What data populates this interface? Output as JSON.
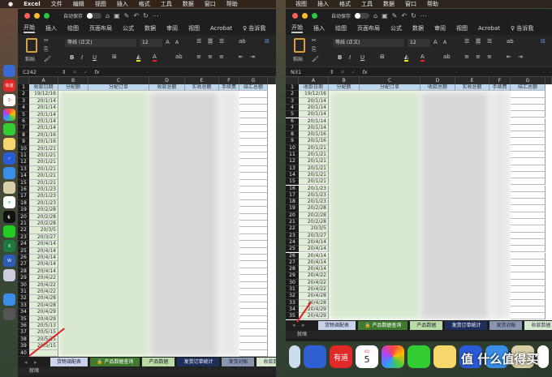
{
  "menubar": {
    "app": "Excel",
    "items": [
      "文件",
      "编辑",
      "视图",
      "插入",
      "格式",
      "工具",
      "数据",
      "窗口",
      "帮助"
    ],
    "right_items": [
      "视图",
      "插入",
      "格式",
      "工具",
      "数据",
      "窗口",
      "帮助"
    ]
  },
  "window": {
    "autosave": "自动保存",
    "toggle": "关闭",
    "tabs": [
      "开始",
      "插入",
      "绘图",
      "页面布局",
      "公式",
      "数据",
      "审阅",
      "视图",
      "Acrobat"
    ],
    "tell_me": "告诉我",
    "paste": "粘贴",
    "font": "等线 (正文)",
    "font_size": "12"
  },
  "left": {
    "cell_ref": "C242",
    "rows": 40
  },
  "right": {
    "cell_ref": "N31",
    "rows": 35
  },
  "columns": [
    "A",
    "B",
    "C",
    "D",
    "E",
    "F",
    "G"
  ],
  "headers": [
    "收款日期",
    "分配额",
    "分配订单",
    "收款总额",
    "实收总额",
    "手续费",
    "结汇总额"
  ],
  "dates": [
    "19/12/16",
    "20/1/14",
    "20/1/14",
    "20/1/14",
    "20/1/14",
    "20/1/14",
    "20/1/16",
    "20/1/16",
    "20/1/21",
    "20/1/21",
    "20/1/21",
    "20/1/21",
    "20/1/21",
    "20/1/21",
    "20/1/23",
    "20/1/23",
    "20/1/23",
    "20/2/28",
    "20/2/28",
    "20/2/28",
    "20/3/5",
    "20/3/27",
    "20/4/14",
    "20/4/14",
    "20/4/14",
    "20/4/14",
    "20/4/14",
    "20/4/22",
    "20/4/22",
    "20/4/22",
    "20/4/28",
    "20/4/28",
    "20/4/29",
    "20/4/29",
    "20/5/13",
    "20/5/15",
    "20/5/15",
    "20/5/15",
    ""
  ],
  "sheet_tabs": [
    "货物调配表",
    "产品数据查询",
    "产品数据",
    "发货订单统计",
    "发货对账",
    "收款数据"
  ],
  "status": "就绪",
  "dock": {
    "youdao": "有道",
    "calendar_day": "5",
    "calendar_month": "4月"
  },
  "watermark": "值 什么值得买"
}
